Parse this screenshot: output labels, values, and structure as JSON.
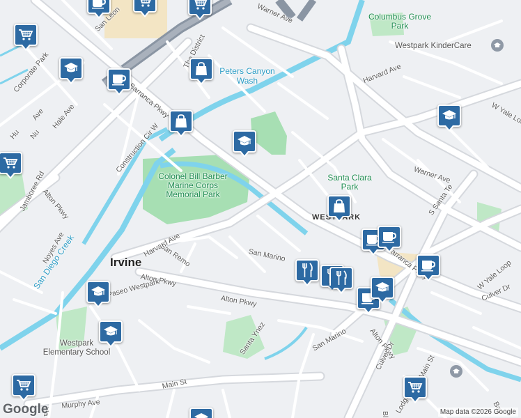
{
  "map": {
    "road_labels": [
      "Warner Ave",
      "Warner Ave",
      "Harvard Ave",
      "Harvard Ave",
      "Barranca Pkwy",
      "Barranca Pkwy",
      "Jamboree Rd",
      "Alton Pkwy",
      "Alton Pkwy",
      "Alton Pkwy",
      "Alton Pkwy",
      "Culver Dr",
      "Culver Dr",
      "Main St",
      "Main St",
      "Murphy Ave",
      "Noyes Ave",
      "Hale Ave",
      "Corporate Park",
      "Construction Cir W",
      "The District",
      "San Leon",
      "San Remo",
      "San Marino",
      "San Marino",
      "Paseo Westpark",
      "Santa Ynez",
      "S Santa Te",
      "W Yale Loop",
      "W Yale Loop",
      "Lodge Rd",
      "Bay",
      "Ave",
      "Nu",
      "Hu",
      "Ha",
      "Bl"
    ],
    "water_labels": [
      "Peters Canyon Wash",
      "San Diego Creek"
    ],
    "park_labels": [
      "Columbus Grove Park",
      "Santa Clara Park",
      "Colonel Bill Barber Marine Corps Memorial Park"
    ],
    "city_label": "Irvine",
    "neighborhood_label": "WESTPARK",
    "poi_labels": [
      "Westpark KinderCare",
      "Westpark Elementary School"
    ],
    "attribution": "Map data ©2026 Google",
    "logo": "Google",
    "pins": [
      {
        "icon": "shopping-cart-icon"
      },
      {
        "icon": "coffee-cup-icon"
      },
      {
        "icon": "shopping-cart-icon"
      },
      {
        "icon": "shopping-cart-icon"
      },
      {
        "icon": "school-icon"
      },
      {
        "icon": "shopping-bag-icon"
      },
      {
        "icon": "coffee-cup-icon"
      },
      {
        "icon": "shopping-bag-icon"
      },
      {
        "icon": "school-icon"
      },
      {
        "icon": "shopping-cart-icon"
      },
      {
        "icon": "school-icon"
      },
      {
        "icon": "shopping-bag-icon"
      },
      {
        "icon": "restaurant-icon"
      },
      {
        "icon": "coffee-cup-icon"
      },
      {
        "icon": "coffee-cup-icon"
      },
      {
        "icon": "restaurant-icon"
      },
      {
        "icon": "restaurant-icon"
      },
      {
        "icon": "coffee-cup-icon"
      },
      {
        "icon": "school-icon"
      },
      {
        "icon": "coffee-cup-icon"
      },
      {
        "icon": "school-icon"
      },
      {
        "icon": "school-icon"
      },
      {
        "icon": "shopping-cart-icon"
      },
      {
        "icon": "shopping-cart-icon"
      },
      {
        "icon": "school-icon"
      }
    ],
    "colors": {
      "pin": "#2d6aa3",
      "park": "#a7dfb3",
      "water": "#7fd3ec",
      "highway": "#8a95a3",
      "road": "#ffffff",
      "commercial": "#f3e5c4"
    }
  }
}
